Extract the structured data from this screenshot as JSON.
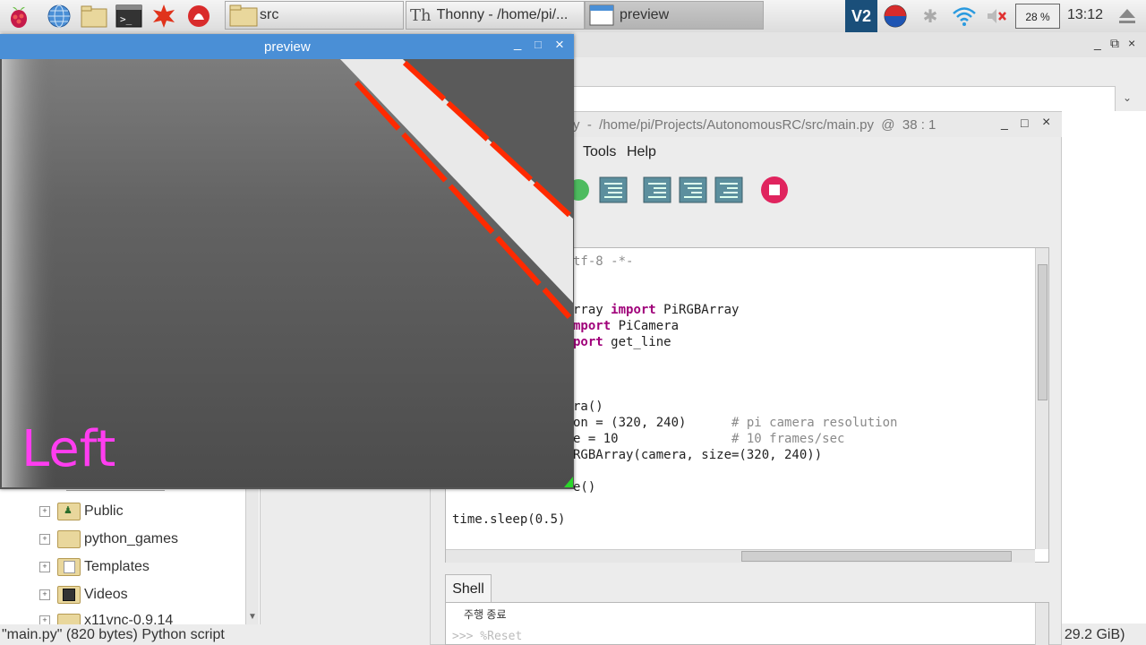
{
  "taskbar": {
    "buttons": [
      {
        "label": "src"
      },
      {
        "label": "Thonny  -  /home/pi/..."
      },
      {
        "label": "preview"
      }
    ],
    "cpu": "28 %",
    "clock": "13:12"
  },
  "file_manager": {
    "tree": [
      {
        "label": "Public",
        "icon": "public-folder-icon"
      },
      {
        "label": "python_games",
        "icon": "folder-icon"
      },
      {
        "label": "Templates",
        "icon": "templates-folder-icon"
      },
      {
        "label": "Videos",
        "icon": "videos-folder-icon"
      },
      {
        "label": "x11vnc-0.9.14",
        "icon": "folder-icon"
      }
    ],
    "status": "\"main.py\" (820 bytes) Python script",
    "free_space": ": 29.2 GiB)"
  },
  "thonny": {
    "title": "y  -  /home/pi/Projects/AutonomousRC/src/main.py  @  38 : 1",
    "menu": [
      "Tools",
      "Help"
    ],
    "code_lines": [
      {
        "t": "tf-8 -*-"
      },
      {
        "t": "rray ",
        "kw": "import",
        "rest": " PiRGBArray"
      },
      {
        "t": "",
        "kw": "mport",
        "rest": " PiCamera"
      },
      {
        "t": "",
        "kw": "port",
        "rest": " get_line"
      },
      {
        "t": "ra()"
      },
      {
        "t": "on = (320, 240)      ",
        "cm": "# pi camera resolution"
      },
      {
        "t": "e = 10               ",
        "cm": "# 10 frames/sec"
      },
      {
        "t": "RGBArray(camera, size=(320, 240))"
      },
      {
        "t": "e()"
      },
      {
        "t": "time.sleep(0.5)"
      }
    ],
    "shell_tab": "Shell",
    "shell_lines": [
      "주행 종료",
      ">>> %Reset"
    ]
  },
  "preview": {
    "title": "preview",
    "overlay_text": "Left",
    "controls": [
      "_",
      "□",
      "×"
    ]
  },
  "colors": {
    "title_bar": "#4a8fd6",
    "line": "#ff2a00",
    "overlay": "#ff3df0",
    "keyword": "#a0007a"
  }
}
